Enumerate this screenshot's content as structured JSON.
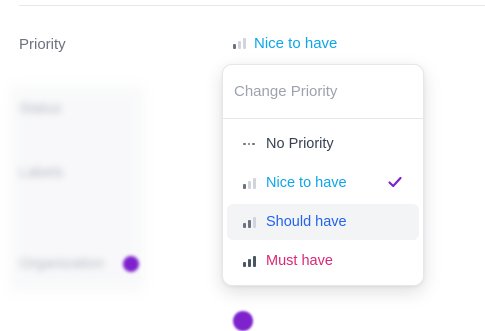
{
  "fields": {
    "priority_label": "Priority",
    "status_label": "Status",
    "labels_label": "Labels",
    "organization_label": "Organization"
  },
  "priority": {
    "current": "Nice to have",
    "current_level": 1,
    "current_color": "#0ea5e9"
  },
  "dropdown": {
    "title": "Change Priority",
    "options": [
      {
        "label": "No Priority",
        "icon": "dots-icon",
        "color": "#374151"
      },
      {
        "label": "Nice to have",
        "icon": "bars-low-icon",
        "color": "#0ea5e9",
        "selected": true
      },
      {
        "label": "Should have",
        "icon": "bars-medium-icon",
        "color": "#2563eb",
        "hovered": true
      },
      {
        "label": "Must have",
        "icon": "bars-high-icon",
        "color": "#db2777"
      }
    ],
    "check_icon": "check-icon",
    "check_color": "#7e22ce"
  }
}
